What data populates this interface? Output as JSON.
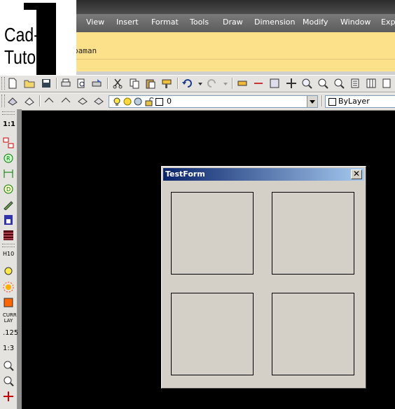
{
  "logo": {
    "line1": "Cad-",
    "line2": "Tutor"
  },
  "menu": {
    "items": [
      "View",
      "Insert",
      "Format",
      "Tools",
      "Draw",
      "Dimension",
      "Modify",
      "Window",
      "Expr"
    ]
  },
  "command_line": {
    "text": "paman"
  },
  "layer_toolbar": {
    "layer_value": "0",
    "color_value": "ByLayer"
  },
  "left_toolbar": {
    "labels": [
      "1:1",
      "H10",
      ".125",
      "1:3",
      "CURR LAY"
    ]
  },
  "dialog": {
    "title": "TestForm",
    "close_glyph": "✕"
  },
  "colors": {
    "command_line_bg": "#fde08a",
    "toolbar_bg": "#e4e3df",
    "dialog_title_start": "#0a246a",
    "dialog_title_end": "#a6caf0",
    "dialog_bg": "#d4d0c8",
    "canvas": "#000000"
  }
}
